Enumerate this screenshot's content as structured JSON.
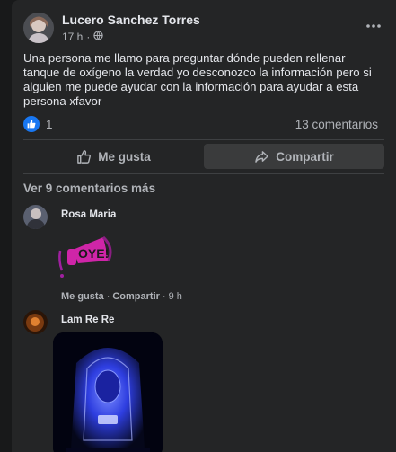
{
  "post": {
    "author": "Lucero Sanchez Torres",
    "time": "17 h",
    "separator": "·",
    "text": "Una persona me llamo para preguntar dónde pueden rellenar tanque de oxígeno la verdad yo desconozco la información pero si alguien me puede ayudar con la información para ayudar a esta persona xfavor",
    "more_icon": "more-options-icon",
    "privacy_icon": "globe-icon"
  },
  "reactions": {
    "count": "1",
    "icon": "like-icon"
  },
  "comments_count": "13 comentarios",
  "actions": {
    "like": "Me gusta",
    "share": "Compartir"
  },
  "view_more": "Ver 9 comentarios más",
  "comments": [
    {
      "name": "Rosa Maria",
      "sticker_text": "OYE!",
      "like_label": "Me gusta",
      "sep": "·",
      "share_label": "Compartir",
      "sep2": "·",
      "time": "9 h"
    },
    {
      "name": "Lam Re Re"
    }
  ],
  "colors": {
    "card": "#242526",
    "page": "#18191a",
    "accent": "#1877f2",
    "text": "#e4e6eb",
    "muted": "#b0b3b8"
  }
}
